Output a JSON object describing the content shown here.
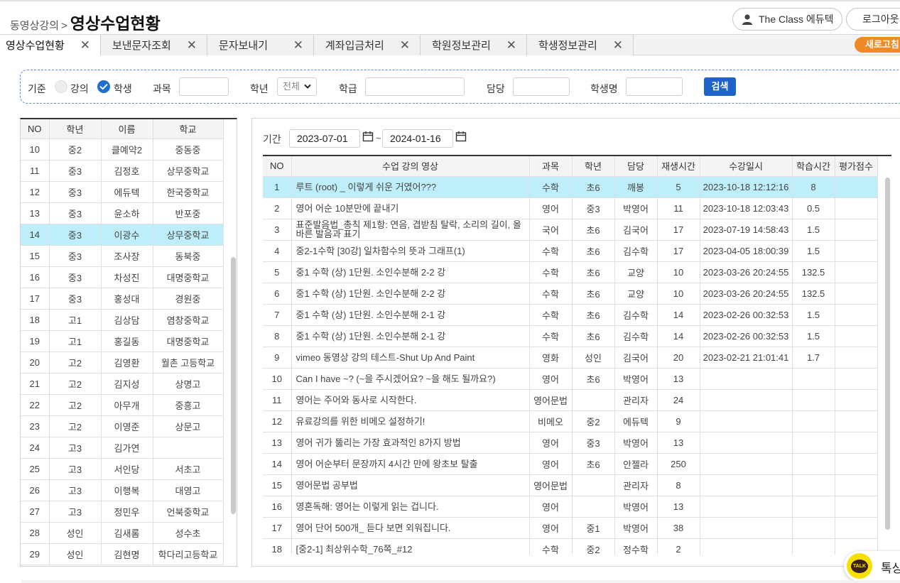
{
  "header": {
    "breadcrumb_parent": "동영상강의",
    "breadcrumb_sep": ">",
    "title": "영상수업현황",
    "user_label": "The Class 에듀텍",
    "logout_label": "로그아웃"
  },
  "tabs": [
    {
      "label": "영상수업현황",
      "close": "✕"
    },
    {
      "label": "보낸문자조회",
      "close": "✕"
    },
    {
      "label": "문자보내기",
      "close": "✕"
    },
    {
      "label": "계좌입금처리",
      "close": "✕"
    },
    {
      "label": "학원정보관리",
      "close": "✕"
    },
    {
      "label": "학생정보관리",
      "close": "✕"
    }
  ],
  "refresh_label": "새로고침",
  "search": {
    "basis_label": "기준",
    "option_lecture": "강의",
    "option_student": "학생",
    "selected_option": "학생",
    "subject_label": "과목",
    "grade_label": "학년",
    "grade_value": "전체",
    "class_label": "학급",
    "teacher_label": "담당",
    "student_name_label": "학생명",
    "search_button": "검색"
  },
  "students": {
    "columns": [
      "NO",
      "학년",
      "이름",
      "학교"
    ],
    "selected_no": "14",
    "rows": [
      [
        "10",
        "중2",
        "클예약2",
        "중동중"
      ],
      [
        "11",
        "중3",
        "김정호",
        "상무중학교"
      ],
      [
        "12",
        "중3",
        "에듀텍",
        "한국중학교"
      ],
      [
        "13",
        "중3",
        "윤소하",
        "반포중"
      ],
      [
        "14",
        "중3",
        "이광수",
        "상무중학교"
      ],
      [
        "15",
        "중3",
        "조사장",
        "동북중"
      ],
      [
        "16",
        "중3",
        "차성진",
        "대명중학교"
      ],
      [
        "17",
        "중3",
        "홍성대",
        "경원중"
      ],
      [
        "18",
        "고1",
        "김상담",
        "염창중학교"
      ],
      [
        "19",
        "고1",
        "홍길동",
        "대명중학교"
      ],
      [
        "20",
        "고2",
        "김영환",
        "월촌 고등학교"
      ],
      [
        "21",
        "고2",
        "김지성",
        "상명고"
      ],
      [
        "22",
        "고2",
        "아무개",
        "중흥고"
      ],
      [
        "23",
        "고2",
        "이영준",
        "상문고"
      ],
      [
        "24",
        "고3",
        "김가연",
        ""
      ],
      [
        "25",
        "고3",
        "서인당",
        "서초고"
      ],
      [
        "26",
        "고3",
        "이행복",
        "대영고"
      ],
      [
        "27",
        "고3",
        "정민우",
        "언북중학교"
      ],
      [
        "28",
        "성인",
        "김새롬",
        "성수초"
      ],
      [
        "29",
        "성인",
        "김현명",
        "학다리고등학교"
      ]
    ]
  },
  "period": {
    "label": "기간",
    "start": "2023-07-01",
    "sep": "~",
    "end": "2024-01-16"
  },
  "lessons": {
    "columns": [
      "NO",
      "수업 강의 영상",
      "과목",
      "학년",
      "담당",
      "재생시간",
      "수강일시",
      "학습시간",
      "평가점수"
    ],
    "selected_no": "1",
    "rows": [
      [
        "1",
        "루트 (root) _ 이렇게 쉬운 거였어???",
        "수학",
        "초6",
        "깨봉",
        "5",
        "2023-10-18 12:12:16",
        "8",
        ""
      ],
      [
        "2",
        "영어 어순 10분만에 끝내기",
        "영어",
        "중3",
        "박영어",
        "11",
        "2023-10-18 12:03:43",
        "0.5",
        ""
      ],
      [
        "3",
        "표준발음법_총칙 제1항: 연음, 겹받침 탈락, 소리의 길이, 올바른 발음과 표기",
        "국어",
        "초6",
        "김국어",
        "17",
        "2023-07-19 14:58:43",
        "1.5",
        ""
      ],
      [
        "4",
        "중2-1수학 [30강] 일차함수의 뜻과 그래프(1)",
        "수학",
        "초6",
        "김수학",
        "17",
        "2023-04-05 18:00:39",
        "1.5",
        ""
      ],
      [
        "5",
        "중1 수학 (상) 1단원. 소인수분해 2-2 강",
        "수학",
        "초6",
        "교양",
        "10",
        "2023-03-26 20:24:55",
        "132.5",
        ""
      ],
      [
        "6",
        "중1 수학 (상) 1단원. 소인수분해 2-2 강",
        "수학",
        "초6",
        "교양",
        "10",
        "2023-03-26 20:24:55",
        "132.5",
        ""
      ],
      [
        "7",
        "중1 수학 (상) 1단원. 소인수분해 2-1 강",
        "수학",
        "초6",
        "김수학",
        "14",
        "2023-02-26 00:32:53",
        "1.5",
        ""
      ],
      [
        "8",
        "중1 수학 (상) 1단원. 소인수분해 2-1 강",
        "수학",
        "초6",
        "김수학",
        "14",
        "2023-02-26 00:32:53",
        "1.5",
        ""
      ],
      [
        "9",
        "vimeo 동영상 강의 테스트-Shut Up And Paint",
        "영화",
        "성인",
        "김국어",
        "20",
        "2023-02-21 21:01:41",
        "1.7",
        ""
      ],
      [
        "10",
        "Can I have ~? (~을 주시겠어요? ~을 해도 될까요?)",
        "영어",
        "초6",
        "박영어",
        "13",
        "",
        "",
        ""
      ],
      [
        "11",
        "영어는 주어와 동사로 시작한다.",
        "영어문법",
        "",
        "관리자",
        "24",
        "",
        "",
        ""
      ],
      [
        "12",
        "유료강의를 위한 비메오 설정하기!",
        "비메오",
        "중2",
        "에듀텍",
        "9",
        "",
        "",
        ""
      ],
      [
        "13",
        "영어 귀가 뚫리는 가장 효과적인 8가지 방법",
        "영어",
        "중3",
        "박영어",
        "13",
        "",
        "",
        ""
      ],
      [
        "14",
        "영어 어순부터 문장까지 4시간 만에 왕초보 탈출",
        "영어",
        "초6",
        "안젤라",
        "250",
        "",
        "",
        ""
      ],
      [
        "15",
        "영어문법 공부법",
        "영어문법",
        "",
        "관리자",
        "8",
        "",
        "",
        ""
      ],
      [
        "16",
        "영혼독해: 영어는 이렇게 읽는 겁니다.",
        "영어",
        "",
        "박영어",
        "13",
        "",
        "",
        ""
      ],
      [
        "17",
        "영어 단어 500개_ 듣다 보면 외워집니다.",
        "영어",
        "중1",
        "박영어",
        "38",
        "",
        "",
        ""
      ],
      [
        "18",
        "[중2-1] 최상위수학_76쪽_#12",
        "수학",
        "중2",
        "정수학",
        "2",
        "",
        "",
        ""
      ]
    ]
  },
  "talk": {
    "icon_text": "TALK",
    "label": "톡상담"
  }
}
